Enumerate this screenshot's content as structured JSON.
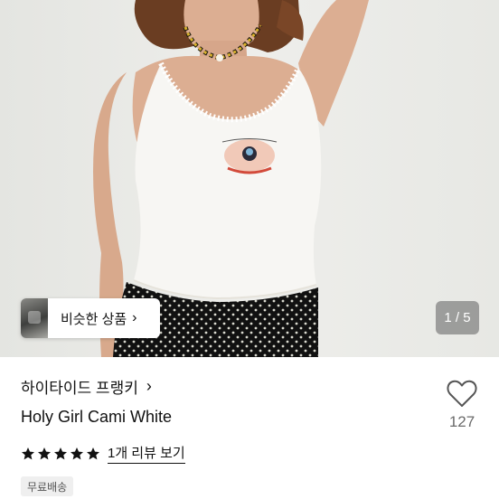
{
  "gallery": {
    "similar_label": "비슷한 상품",
    "page_indicator": "1 / 5"
  },
  "product": {
    "brand": "하이타이드 프랭키",
    "title": "Holy Girl Cami White",
    "like_count": "127",
    "review_link": "1개 리뷰 보기",
    "rating": 5,
    "badge": "무료배송"
  },
  "icons": {
    "brand_chevron": "chevron-right-icon",
    "similar_chevron": "chevron-right-icon",
    "like": "heart-outline-icon",
    "star": "star-filled-icon"
  },
  "colors": {
    "text": "#111111",
    "muted": "#6b6b6b",
    "pager_bg": "#6e6e6e",
    "badge_bg": "#efefef"
  }
}
